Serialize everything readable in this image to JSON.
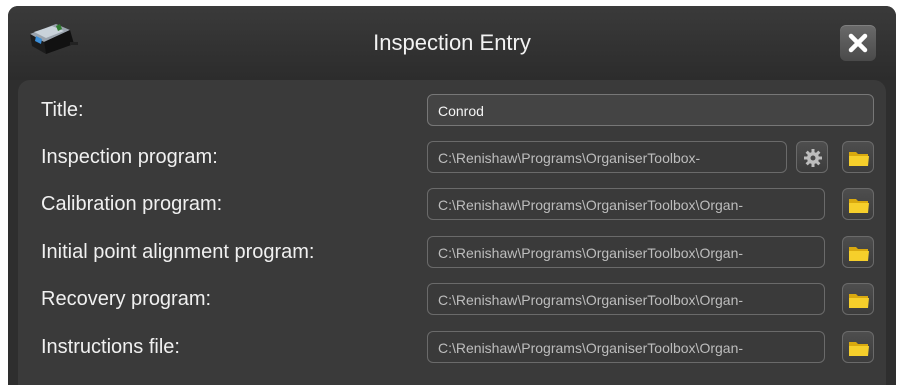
{
  "window": {
    "title": "Inspection Entry",
    "app_icon": "folder-cmm-icon",
    "close_icon": "close-icon"
  },
  "form": {
    "title": {
      "label": "Title:",
      "value": "Conrod"
    },
    "inspection_program": {
      "label": "Inspection program:",
      "value": "C:\\Renishaw\\Programs\\OrganiserToolbox-",
      "settings_icon": "gear-icon",
      "browse_icon": "folder-icon"
    },
    "calibration_program": {
      "label": "Calibration program:",
      "value": "C:\\Renishaw\\Programs\\OrganiserToolbox\\Organ-",
      "browse_icon": "folder-icon"
    },
    "alignment_program": {
      "label": "Initial point alignment program:",
      "value": "C:\\Renishaw\\Programs\\OrganiserToolbox\\Organ-",
      "browse_icon": "folder-icon"
    },
    "recovery_program": {
      "label": "Recovery program:",
      "value": "C:\\Renishaw\\Programs\\OrganiserToolbox\\Organ-",
      "browse_icon": "folder-icon"
    },
    "instructions_file": {
      "label": "Instructions file:",
      "value": "C:\\Renishaw\\Programs\\OrganiserToolbox\\Organ-",
      "browse_icon": "folder-icon"
    }
  },
  "colors": {
    "background": "#2e2e2e",
    "panel": "#3a3a3a",
    "folder": "#f2c21a",
    "text": "#f0f0f0",
    "path_text": "#bdbdbd"
  }
}
